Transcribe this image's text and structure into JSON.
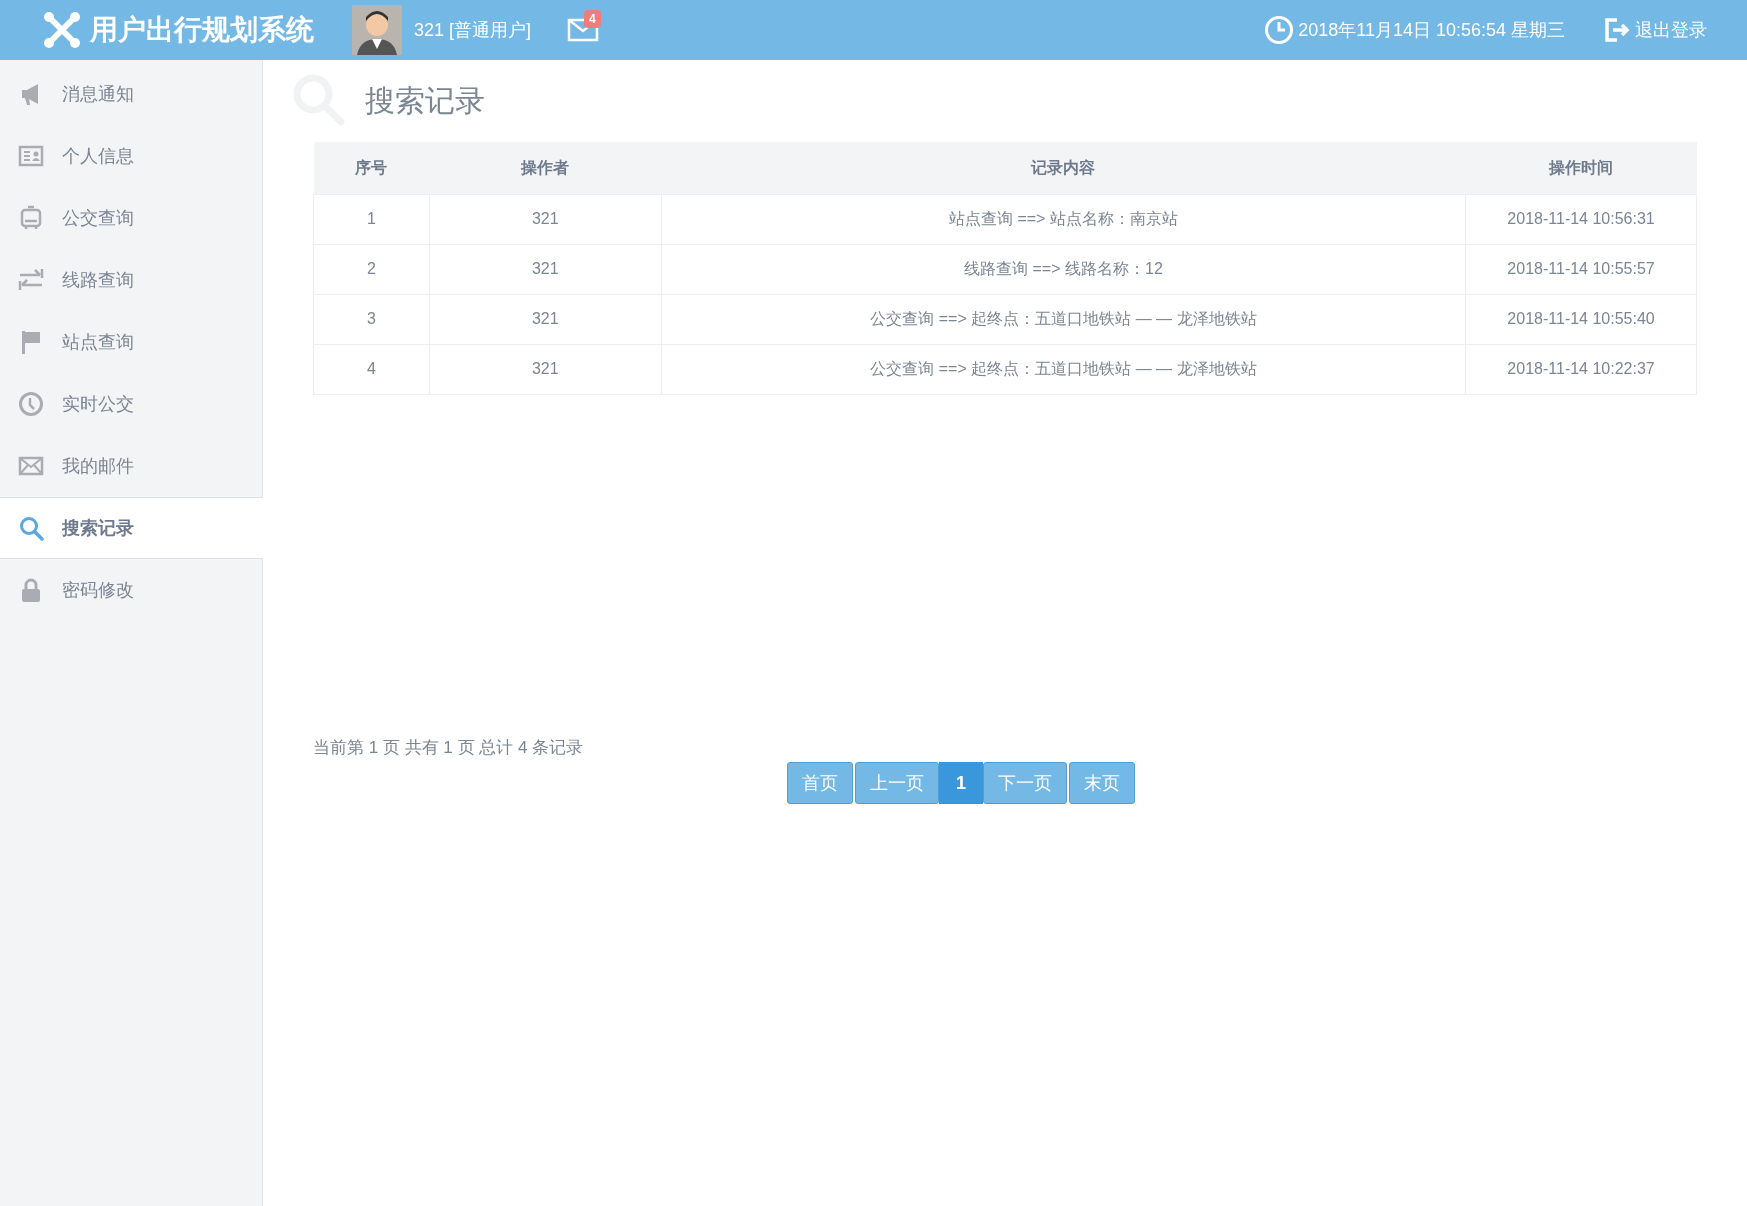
{
  "header": {
    "title": "用户出行规划系统",
    "user": "321 [普通用户]",
    "mail_badge": "4",
    "datetime": "2018年11月14日 10:56:54 星期三",
    "logout": "退出登录"
  },
  "sidebar": {
    "items": [
      {
        "label": "消息通知",
        "selected": false
      },
      {
        "label": "个人信息",
        "selected": false
      },
      {
        "label": "公交查询",
        "selected": false
      },
      {
        "label": "线路查询",
        "selected": false
      },
      {
        "label": "站点查询",
        "selected": false
      },
      {
        "label": "实时公交",
        "selected": false
      },
      {
        "label": "我的邮件",
        "selected": false
      },
      {
        "label": "搜索记录",
        "selected": true
      },
      {
        "label": "密码修改",
        "selected": false
      }
    ]
  },
  "page_title": "搜索记录",
  "table": {
    "columns": [
      "序号",
      "操作者",
      "记录内容",
      "操作时间"
    ],
    "rows": [
      [
        "1",
        "321",
        "站点查询 ==> 站点名称：南京站",
        "2018-11-14 10:56:31"
      ],
      [
        "2",
        "321",
        "线路查询 ==> 线路名称：12",
        "2018-11-14 10:55:57"
      ],
      [
        "3",
        "321",
        "公交查询 ==> 起终点：五道口地铁站 — — 龙泽地铁站",
        "2018-11-14 10:55:40"
      ],
      [
        "4",
        "321",
        "公交查询 ==> 起终点：五道口地铁站 — — 龙泽地铁站",
        "2018-11-14 10:22:37"
      ]
    ]
  },
  "pagination": {
    "summary": "当前第 1 页 共有 1 页 总计 4 条记录",
    "buttons": [
      {
        "label": "首页",
        "selected": false
      },
      {
        "label": "上一页",
        "selected": false
      },
      {
        "label": "1",
        "selected": true
      },
      {
        "label": "下一页",
        "selected": false
      },
      {
        "label": "末页",
        "selected": false
      }
    ]
  }
}
